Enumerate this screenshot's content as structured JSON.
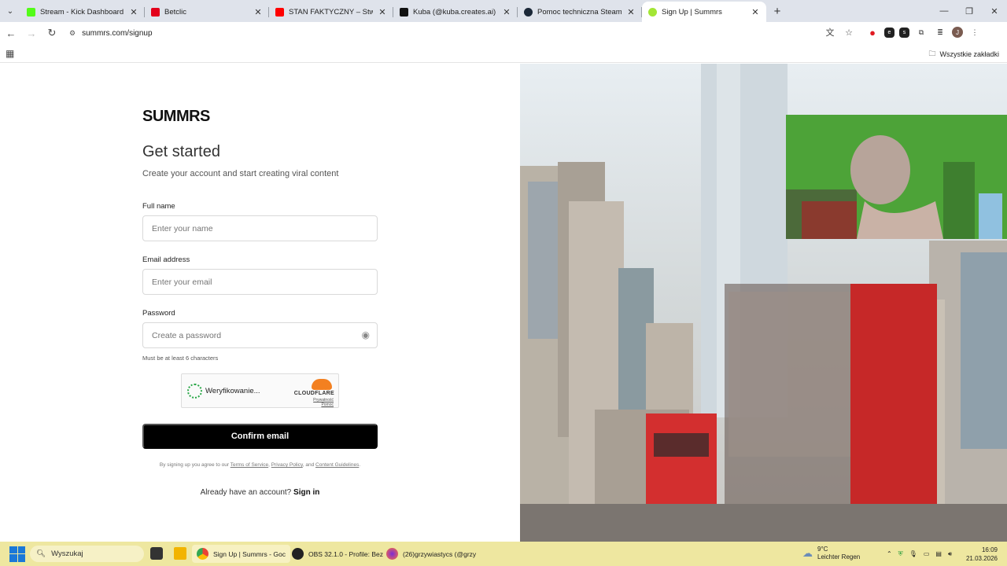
{
  "browser": {
    "tabs": [
      {
        "title": "Stream - Kick Dashboard",
        "favicon_color": "#53fc18"
      },
      {
        "title": "Betclic",
        "favicon_color": "#e3001b"
      },
      {
        "title": "STAN FAKTYCZNY – Stworzyliś",
        "favicon_color": "#ff0000"
      },
      {
        "title": "Kuba (@kuba.creates.ai) | TikTo",
        "favicon_color": "#111111"
      },
      {
        "title": "Pomoc techniczna Steam - Moj",
        "favicon_color": "#1b2838"
      },
      {
        "title": "Sign Up | Summrs",
        "favicon_color": "#a3e635",
        "active": true
      }
    ],
    "url": "summrs.com/signup",
    "bookmarks_all": "Wszystkie zakładki",
    "profile_initial": "J"
  },
  "signup": {
    "logo": "SUMMRS",
    "title": "Get started",
    "subtitle": "Create your account and start creating viral content",
    "full_name_label": "Full name",
    "full_name_placeholder": "Enter your name",
    "email_label": "Email address",
    "email_placeholder": "Enter your email",
    "password_label": "Password",
    "password_placeholder": "Create a password",
    "password_hint": "Must be at least 6 characters",
    "captcha": {
      "status": "Weryfikowanie...",
      "brand": "CLOUDFLARE",
      "privacy": "Prywatność",
      "help": "Pomoc"
    },
    "confirm_button": "Confirm email",
    "legal_prefix": "By signing up you agree to our",
    "terms": "Terms of Service",
    "privacy": "Privacy Policy",
    "and": ", and",
    "guidelines": "Content Guidelines",
    "already_text": "Already have an account?",
    "sign_in": "Sign in"
  },
  "taskbar": {
    "search_placeholder": "Wyszukaj",
    "apps": [
      {
        "label": "Sign Up | Summrs - Goc"
      },
      {
        "label": "OBS 32.1.0 - Profile: Bez"
      },
      {
        "label": "(26)grzywiastycs (@grzy"
      }
    ],
    "weather_temp": "9°C",
    "weather_desc": "Leichter Regen",
    "time": "16:09",
    "date": "21.03.2026"
  }
}
